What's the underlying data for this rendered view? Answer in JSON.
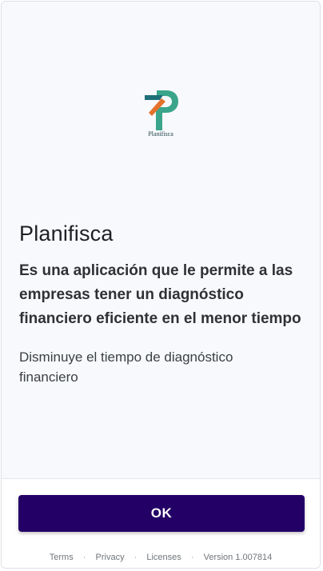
{
  "app": {
    "logo_text": "Planifisca",
    "title": "Planifisca",
    "subtitle": "Es una aplicación que le permite a las empresas tener un diagnóstico financiero eficiente en el menor tiempo",
    "description": "Disminuye el tiempo de diagnóstico financiero"
  },
  "actions": {
    "ok_label": "OK"
  },
  "footer": {
    "terms": "Terms",
    "privacy": "Privacy",
    "licenses": "Licenses",
    "version": "Version 1.007814",
    "separator": "·"
  },
  "colors": {
    "button_bg": "#230066",
    "logo_green": "#3aa58a",
    "logo_orange": "#e4722c",
    "logo_teal": "#1f6f78"
  },
  "icons": {
    "logo": "planifisca-logo-icon"
  }
}
